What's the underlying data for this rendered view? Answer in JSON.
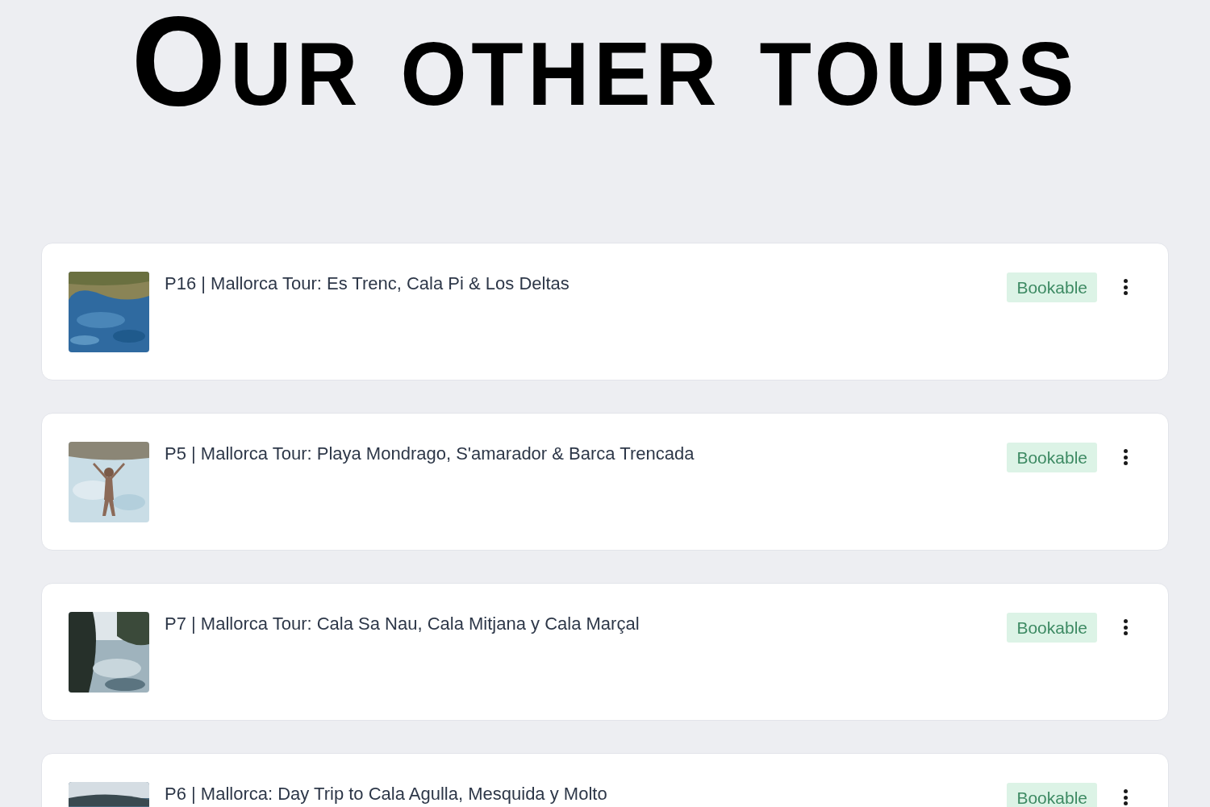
{
  "heading": "Our other tours",
  "tours": [
    {
      "title": "P16 | Mallorca Tour: Es Trenc, Cala Pi & Los Deltas",
      "status": "Bookable"
    },
    {
      "title": "P5 | Mallorca Tour: Playa Mondrago, S'amarador & Barca Trencada",
      "status": "Bookable"
    },
    {
      "title": "P7 | Mallorca Tour: Cala Sa Nau, Cala Mitjana y Cala Marçal",
      "status": "Bookable"
    },
    {
      "title": "P6 | Mallorca: Day Trip to Cala Agulla, Mesquida y Molto",
      "status": "Bookable"
    }
  ]
}
